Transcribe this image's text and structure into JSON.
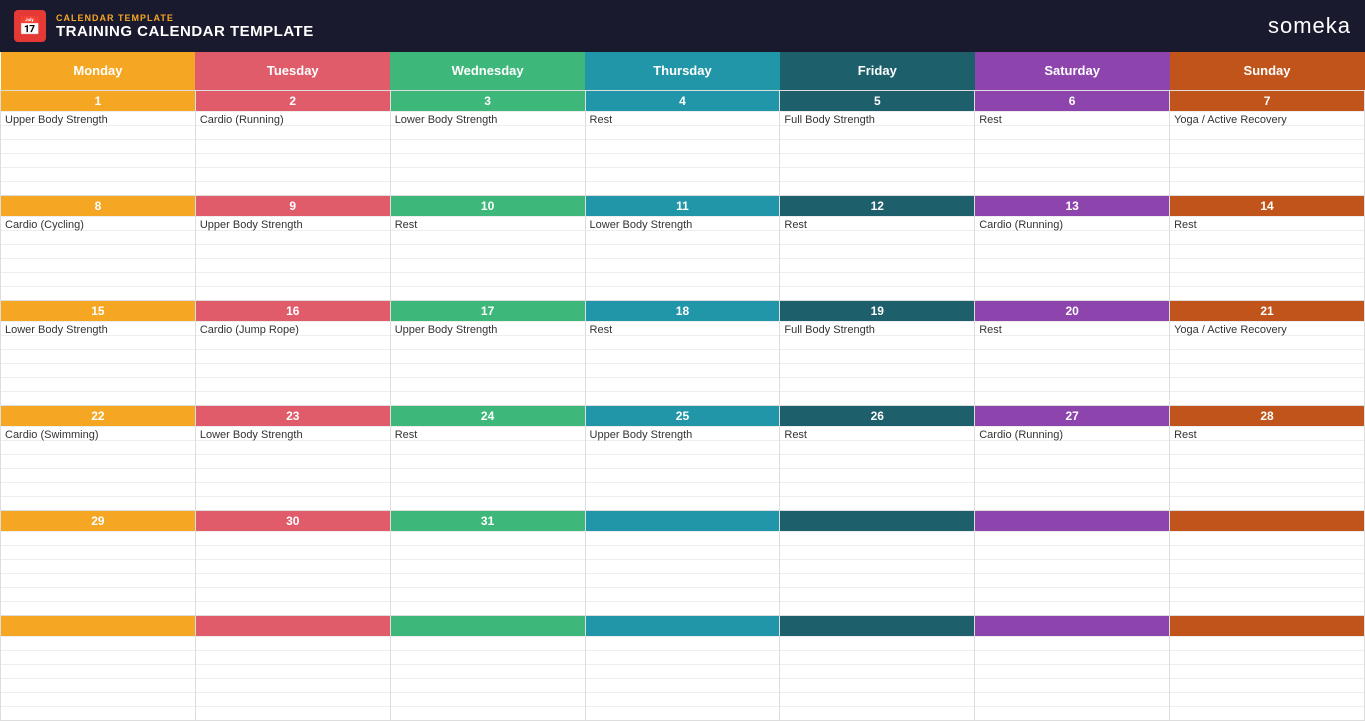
{
  "header": {
    "sub_label": "CALENDAR TEMPLATE",
    "title": "TRAINING CALENDAR TEMPLATE",
    "brand": "someka",
    "icon": "📅"
  },
  "days": [
    "Monday",
    "Tuesday",
    "Wednesday",
    "Thursday",
    "Friday",
    "Saturday",
    "Sunday"
  ],
  "day_colors": [
    "col-mon",
    "col-tue",
    "col-wed",
    "col-thu",
    "col-fri",
    "col-sat",
    "col-sun"
  ],
  "weeks": [
    {
      "days": [
        {
          "num": "1",
          "activity": "Upper Body Strength",
          "col": "col-mon"
        },
        {
          "num": "2",
          "activity": "Cardio (Running)",
          "col": "col-tue"
        },
        {
          "num": "3",
          "activity": "Lower Body Strength",
          "col": "col-wed"
        },
        {
          "num": "4",
          "activity": "Rest",
          "col": "col-thu"
        },
        {
          "num": "5",
          "activity": "Full Body Strength",
          "col": "col-fri"
        },
        {
          "num": "6",
          "activity": "Rest",
          "col": "col-sat"
        },
        {
          "num": "7",
          "activity": "Yoga / Active Recovery",
          "col": "col-sun"
        }
      ]
    },
    {
      "days": [
        {
          "num": "8",
          "activity": "Cardio (Cycling)",
          "col": "col-mon"
        },
        {
          "num": "9",
          "activity": "Upper Body Strength",
          "col": "col-tue"
        },
        {
          "num": "10",
          "activity": "Rest",
          "col": "col-wed"
        },
        {
          "num": "11",
          "activity": "Lower Body Strength",
          "col": "col-thu"
        },
        {
          "num": "12",
          "activity": "Rest",
          "col": "col-fri"
        },
        {
          "num": "13",
          "activity": "Cardio (Running)",
          "col": "col-sat"
        },
        {
          "num": "14",
          "activity": "Rest",
          "col": "col-sun"
        }
      ]
    },
    {
      "days": [
        {
          "num": "15",
          "activity": "Lower Body Strength",
          "col": "col-mon"
        },
        {
          "num": "16",
          "activity": "Cardio (Jump Rope)",
          "col": "col-tue"
        },
        {
          "num": "17",
          "activity": "Upper Body Strength",
          "col": "col-wed"
        },
        {
          "num": "18",
          "activity": "Rest",
          "col": "col-thu"
        },
        {
          "num": "19",
          "activity": "Full Body Strength",
          "col": "col-fri"
        },
        {
          "num": "20",
          "activity": "Rest",
          "col": "col-sat"
        },
        {
          "num": "21",
          "activity": "Yoga / Active Recovery",
          "col": "col-sun"
        }
      ]
    },
    {
      "days": [
        {
          "num": "22",
          "activity": "Cardio (Swimming)",
          "col": "col-mon"
        },
        {
          "num": "23",
          "activity": "Lower Body Strength",
          "col": "col-tue"
        },
        {
          "num": "24",
          "activity": "Rest",
          "col": "col-wed"
        },
        {
          "num": "25",
          "activity": "Upper Body Strength",
          "col": "col-thu"
        },
        {
          "num": "26",
          "activity": "Rest",
          "col": "col-fri"
        },
        {
          "num": "27",
          "activity": "Cardio (Running)",
          "col": "col-sat"
        },
        {
          "num": "28",
          "activity": "Rest",
          "col": "col-sun"
        }
      ]
    },
    {
      "days": [
        {
          "num": "29",
          "activity": "",
          "col": "col-mon"
        },
        {
          "num": "30",
          "activity": "",
          "col": "col-tue"
        },
        {
          "num": "31",
          "activity": "",
          "col": "col-wed"
        },
        {
          "num": "",
          "activity": "",
          "col": "col-thu"
        },
        {
          "num": "",
          "activity": "",
          "col": "col-fri"
        },
        {
          "num": "",
          "activity": "",
          "col": "col-sat"
        },
        {
          "num": "",
          "activity": "",
          "col": "col-sun"
        }
      ]
    },
    {
      "days": [
        {
          "num": "",
          "activity": "",
          "col": "col-mon"
        },
        {
          "num": "",
          "activity": "",
          "col": "col-tue"
        },
        {
          "num": "",
          "activity": "",
          "col": "col-wed"
        },
        {
          "num": "",
          "activity": "",
          "col": "col-thu"
        },
        {
          "num": "",
          "activity": "",
          "col": "col-fri"
        },
        {
          "num": "",
          "activity": "",
          "col": "col-sat"
        },
        {
          "num": "",
          "activity": "",
          "col": "col-sun"
        }
      ]
    }
  ]
}
